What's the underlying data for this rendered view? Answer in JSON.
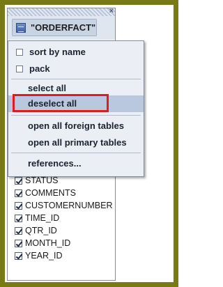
{
  "table": {
    "name": "\"ORDERFACT\"",
    "close_glyph": "×"
  },
  "context_menu": {
    "items": [
      {
        "label": "sort by name",
        "checkbox": true,
        "checked": false
      },
      {
        "label": "pack",
        "checkbox": true,
        "checked": false
      },
      {
        "label": "select all"
      },
      {
        "label": "deselect all",
        "hovered": true,
        "highlighted": true
      },
      {
        "label": "open all foreign tables"
      },
      {
        "label": "open all primary tables"
      },
      {
        "label": "references..."
      }
    ]
  },
  "columns": [
    {
      "name": "STATUS",
      "checked": true
    },
    {
      "name": "COMMENTS",
      "checked": true
    },
    {
      "name": "CUSTOMERNUMBER",
      "checked": true
    },
    {
      "name": "TIME_ID",
      "checked": true
    },
    {
      "name": "QTR_ID",
      "checked": true
    },
    {
      "name": "MONTH_ID",
      "checked": true
    },
    {
      "name": "YEAR_ID",
      "checked": true
    }
  ],
  "colors": {
    "frame_border": "#7a7a14",
    "menu_background": "#ebeff5",
    "hover_background": "#b9c8df",
    "highlight_box": "#e01b1b"
  }
}
